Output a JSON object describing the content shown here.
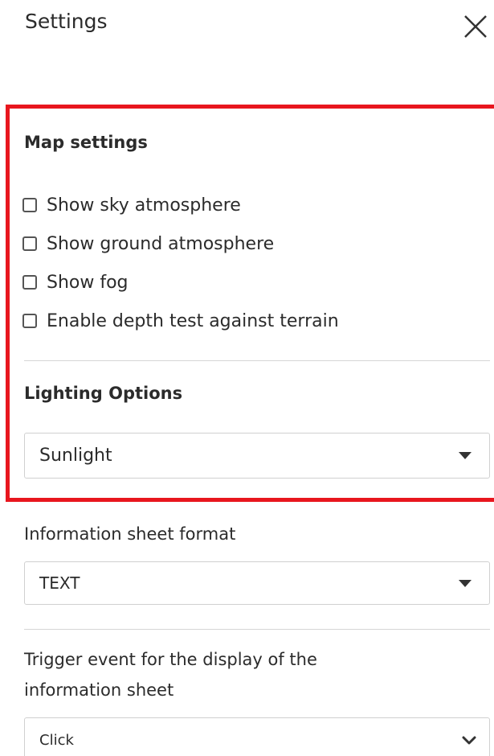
{
  "panel": {
    "title": "Settings"
  },
  "map_settings": {
    "heading": "Map settings",
    "options": [
      {
        "label": "Show sky atmosphere",
        "checked": false
      },
      {
        "label": "Show ground atmosphere",
        "checked": false
      },
      {
        "label": "Show fog",
        "checked": false
      },
      {
        "label": "Enable depth test against terrain",
        "checked": false
      }
    ]
  },
  "lighting": {
    "heading": "Lighting Options",
    "selected": "Sunlight"
  },
  "info_sheet_format": {
    "heading": "Information sheet format",
    "selected": "TEXT"
  },
  "trigger_event": {
    "heading_line1": "Trigger event for the display of the",
    "heading_line2": "information sheet",
    "selected": "Click"
  },
  "colors": {
    "highlight_border": "#e8161e",
    "divider": "#d6d6d6"
  }
}
